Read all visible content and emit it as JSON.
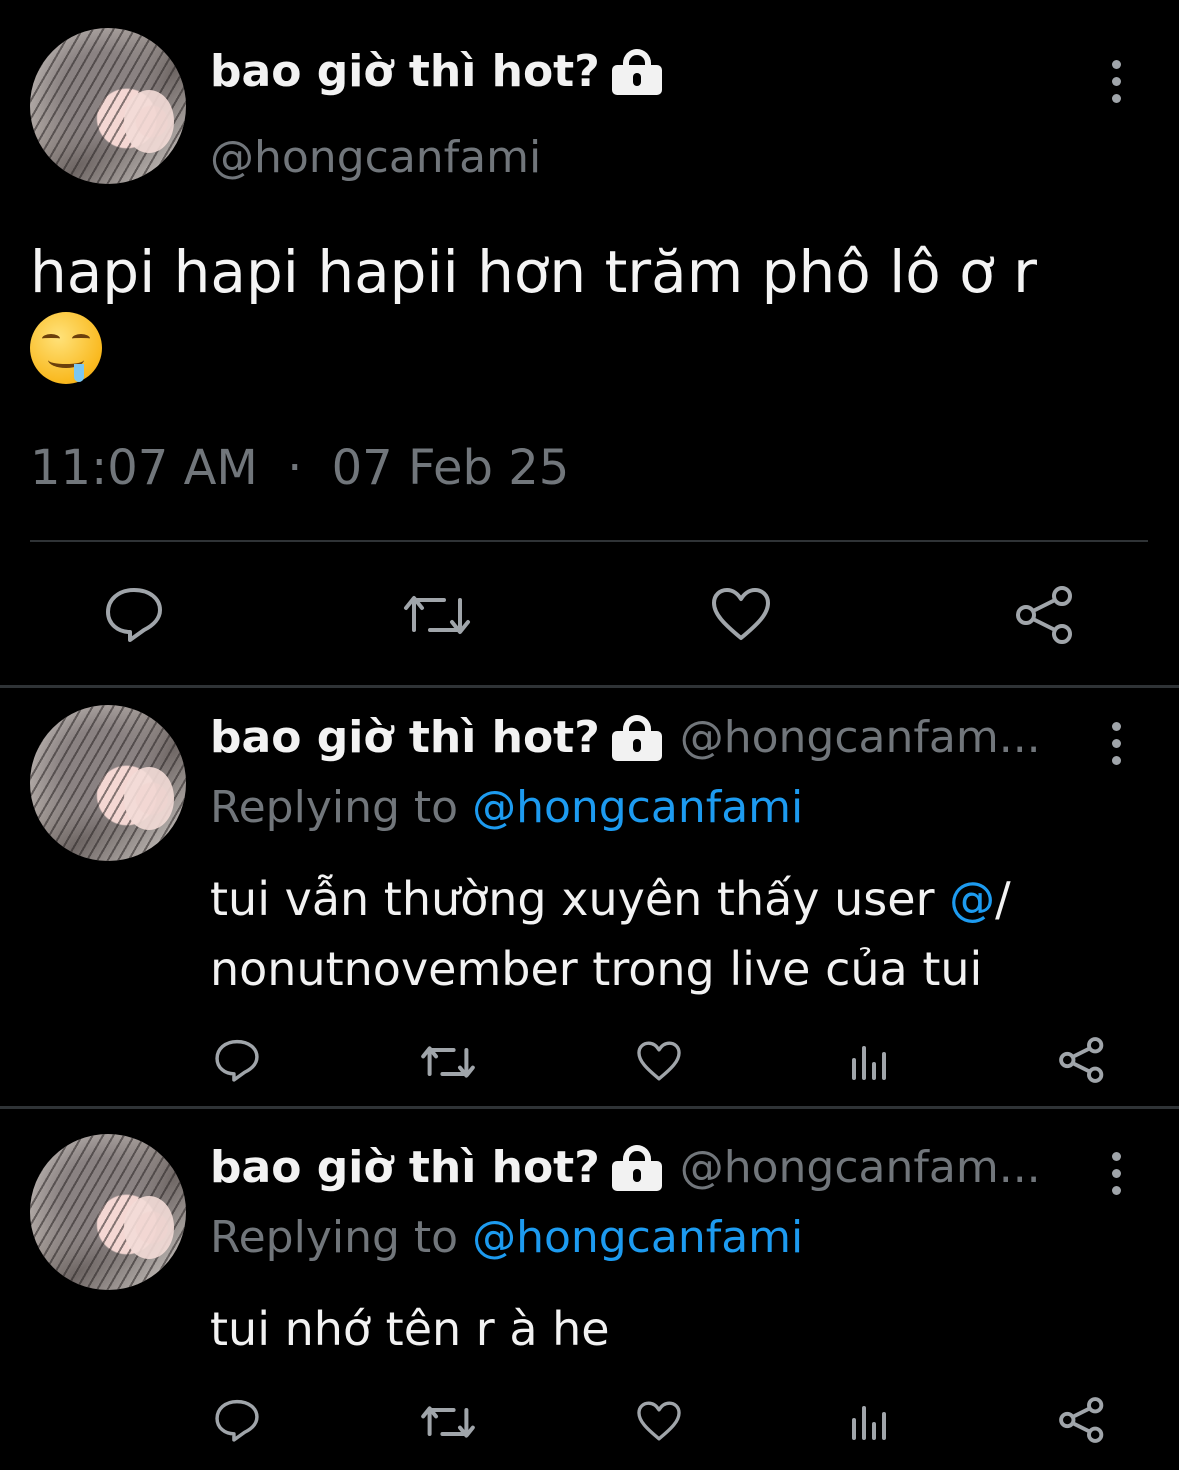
{
  "main_tweet": {
    "display_name": "bao giờ thì hot?",
    "handle": "@hongcanfami",
    "text": "hapi hapi hapii hơn trăm phô lô ơ r",
    "emoji": "🤤",
    "timestamp": "11:07 AM",
    "separator": "·",
    "date": "07 Feb 25",
    "actions": [
      "reply-icon",
      "retweet-icon",
      "like-icon",
      "share-icon"
    ]
  },
  "replies": [
    {
      "display_name": "bao giờ thì hot?",
      "handle": "@hongcanfam...",
      "replying_prefix": "Replying to",
      "replying_to": "@hongcanfami",
      "text_before": "tui vẫn thường xuyên thấy user ",
      "mention": "@",
      "text_after": "/ nonutnovember trong live của tui",
      "actions": [
        "reply-icon",
        "retweet-icon",
        "like-icon",
        "views-icon",
        "share-icon"
      ]
    },
    {
      "display_name": "bao giờ thì hot?",
      "handle": "@hongcanfam...",
      "replying_prefix": "Replying to",
      "replying_to": "@hongcanfami",
      "text_before": "tui nhớ tên r à he",
      "mention": "",
      "text_after": "",
      "actions": [
        "reply-icon",
        "retweet-icon",
        "like-icon",
        "views-icon",
        "share-icon"
      ]
    }
  ],
  "colors": {
    "background": "#000000",
    "text": "#e7e9ea",
    "secondary": "#71767b",
    "accent": "#1d9bf0",
    "divider": "#2f3336"
  }
}
